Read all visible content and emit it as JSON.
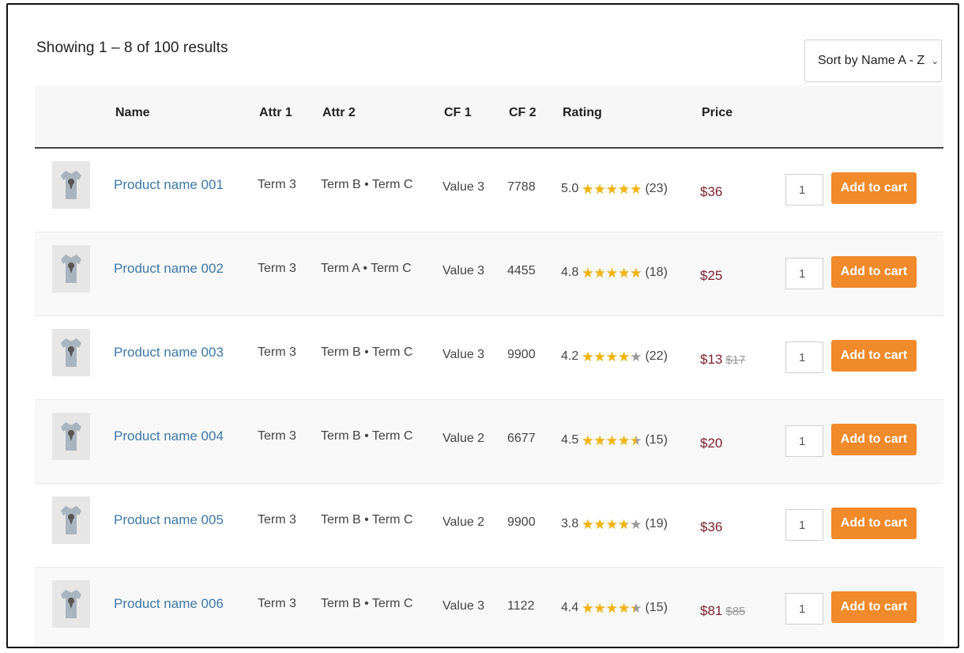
{
  "results_text": "Showing 1 – 8 of 100 results",
  "sort": {
    "label": "Sort by Name A - Z",
    "icon": "chevron-down-icon"
  },
  "columns": {
    "name": "Name",
    "attr1": "Attr 1",
    "attr2": "Attr 2",
    "cf1": "CF 1",
    "cf2": "CF 2",
    "rating": "Rating",
    "price": "Price"
  },
  "colors": {
    "link": "#3d78a8",
    "price": "#7a1f2b",
    "button": "#f08a2b",
    "star": "#f4b400"
  },
  "products": [
    {
      "name": "Product name 001",
      "attr1": "Term 3",
      "attr2": "Term B • Term C",
      "cf1": "Value 3",
      "cf2": "7788",
      "rating": "5.0",
      "stars": 5.0,
      "reviews": "(23)",
      "price": "$36",
      "old_price": "",
      "qty": "1",
      "cart_label": "Add to cart"
    },
    {
      "name": "Product name 002",
      "attr1": "Term 3",
      "attr2": "Term A • Term C",
      "cf1": "Value 3",
      "cf2": "4455",
      "rating": "4.8",
      "stars": 4.8,
      "reviews": "(18)",
      "price": "$25",
      "old_price": "",
      "qty": "1",
      "cart_label": "Add to cart"
    },
    {
      "name": "Product name 003",
      "attr1": "Term 3",
      "attr2": "Term B • Term C",
      "cf1": "Value 3",
      "cf2": "9900",
      "rating": "4.2",
      "stars": 4.2,
      "reviews": "(22)",
      "price": "$13",
      "old_price": "$17",
      "qty": "1",
      "cart_label": "Add to cart"
    },
    {
      "name": "Product name 004",
      "attr1": "Term 3",
      "attr2": "Term B • Term C",
      "cf1": "Value 2",
      "cf2": "6677",
      "rating": "4.5",
      "stars": 4.5,
      "reviews": "(15)",
      "price": "$20",
      "old_price": "",
      "qty": "1",
      "cart_label": "Add to cart"
    },
    {
      "name": "Product name 005",
      "attr1": "Term 3",
      "attr2": "Term B • Term C",
      "cf1": "Value 2",
      "cf2": "9900",
      "rating": "3.8",
      "stars": 3.8,
      "reviews": "(19)",
      "price": "$36",
      "old_price": "",
      "qty": "1",
      "cart_label": "Add to cart"
    },
    {
      "name": "Product name 006",
      "attr1": "Term 3",
      "attr2": "Term B • Term C",
      "cf1": "Value 3",
      "cf2": "1122",
      "rating": "4.4",
      "stars": 4.4,
      "reviews": "(15)",
      "price": "$81",
      "old_price": "$85",
      "qty": "1",
      "cart_label": "Add to cart"
    }
  ]
}
